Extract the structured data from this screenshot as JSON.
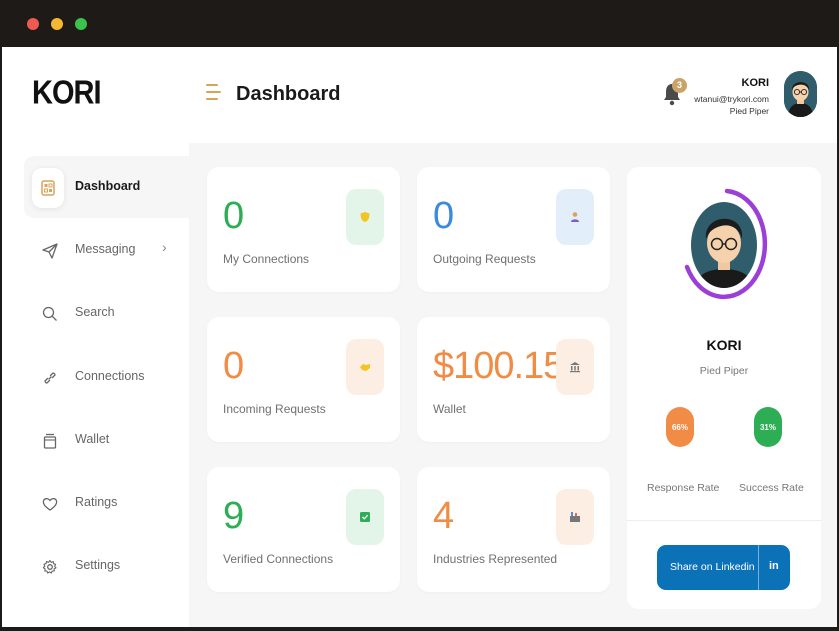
{
  "app": {
    "logo": "KORI",
    "page_title": "Dashboard"
  },
  "header": {
    "notification_count": "3",
    "user_name": "KORI",
    "user_email": "wtanui@trykori.com",
    "user_company": "Pied Piper"
  },
  "sidebar": {
    "items": [
      {
        "label": "Dashboard",
        "icon": "dashboard-icon",
        "active": true
      },
      {
        "label": "Messaging",
        "icon": "paper-plane-icon",
        "active": false
      },
      {
        "label": "Search",
        "icon": "search-icon",
        "active": false
      },
      {
        "label": "Connections",
        "icon": "link-icon",
        "active": false
      },
      {
        "label": "Wallet",
        "icon": "wallet-icon",
        "active": false
      },
      {
        "label": "Ratings",
        "icon": "heart-icon",
        "active": false
      },
      {
        "label": "Settings",
        "icon": "gear-icon",
        "active": false
      }
    ]
  },
  "stats": [
    {
      "value": "0",
      "label": "My Connections",
      "color": "#2dae54",
      "icon": "shield-icon"
    },
    {
      "value": "0",
      "label": "Outgoing Requests",
      "color": "#3b8bdc",
      "icon": "person-icon"
    },
    {
      "value": "0",
      "label": "Incoming Requests",
      "color": "#f08c45",
      "icon": "handshake-icon"
    },
    {
      "value": "$100.15",
      "label": "Wallet",
      "color": "#f08c45",
      "icon": "bank-icon"
    },
    {
      "value": "9",
      "label": "Verified Connections",
      "color": "#2dae54",
      "icon": "check-icon"
    },
    {
      "value": "4",
      "label": "Industries Represented",
      "color": "#f08c45",
      "icon": "factory-icon"
    }
  ],
  "profile": {
    "name": "KORI",
    "company": "Pied Piper",
    "response_rate": "66%",
    "response_rate_label": "Response Rate",
    "success_rate": "31%",
    "success_rate_label": "Success Rate",
    "share_label": "Share on Linkedin",
    "share_icon_text": "in"
  },
  "colors": {
    "accent_orange": "#f08c45",
    "accent_green": "#2dae54",
    "accent_blue": "#3b8bdc",
    "linkedin_blue": "#0c72b8",
    "ring_purple": "#9b3fd6"
  }
}
